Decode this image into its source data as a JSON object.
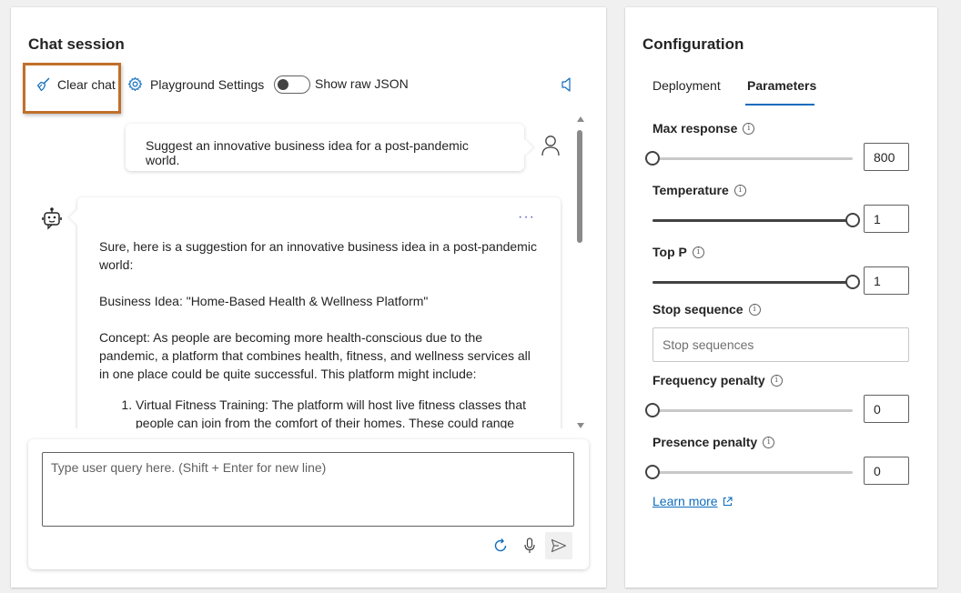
{
  "chat": {
    "title": "Chat session",
    "toolbar": {
      "clear_chat_label": "Clear chat",
      "playground_settings_label": "Playground Settings",
      "show_raw_json_label": "Show raw JSON",
      "show_raw_json_on": false
    },
    "messages": {
      "user_text": "Suggest an innovative business idea for a post-pandemic world.",
      "assistant_paragraph_1": "Sure, here is a suggestion for an innovative business idea in a post-pandemic world:",
      "assistant_paragraph_2": "Business Idea: \"Home-Based Health & Wellness Platform\"",
      "assistant_paragraph_3": "Concept: As people are becoming more health-conscious due to the pandemic, a platform that combines health, fitness, and wellness services all in one place could be quite successful. This platform might include:",
      "assistant_list_item_1": "Virtual Fitness Training: The platform will host live fitness classes that people can join from the comfort of their homes. These could range",
      "more_options": "···"
    },
    "input": {
      "placeholder": "Type user query here. (Shift + Enter for new line)",
      "value": ""
    },
    "icons": {
      "clear": "broom-icon",
      "settings": "gear-icon",
      "speaker": "speaker-icon",
      "user": "user-avatar-icon",
      "bot": "bot-avatar-icon",
      "regenerate": "refresh-icon",
      "mic": "microphone-icon",
      "send": "send-icon"
    },
    "highlight_color": "#c0702a"
  },
  "config": {
    "title": "Configuration",
    "tabs": [
      {
        "label": "Deployment",
        "active": false
      },
      {
        "label": "Parameters",
        "active": true
      }
    ],
    "params": {
      "max_response": {
        "label": "Max response",
        "value": "800",
        "fraction": 0.0
      },
      "temperature": {
        "label": "Temperature",
        "value": "1",
        "fraction": 1.0
      },
      "top_p": {
        "label": "Top P",
        "value": "1",
        "fraction": 1.0
      },
      "stop_sequence": {
        "label": "Stop sequence",
        "placeholder": "Stop sequences",
        "value": ""
      },
      "frequency_penalty": {
        "label": "Frequency penalty",
        "value": "0",
        "fraction": 0.0
      },
      "presence_penalty": {
        "label": "Presence penalty",
        "value": "0",
        "fraction": 0.0
      }
    },
    "learn_more_label": "Learn more",
    "accent_color": "#0f6cbd"
  }
}
